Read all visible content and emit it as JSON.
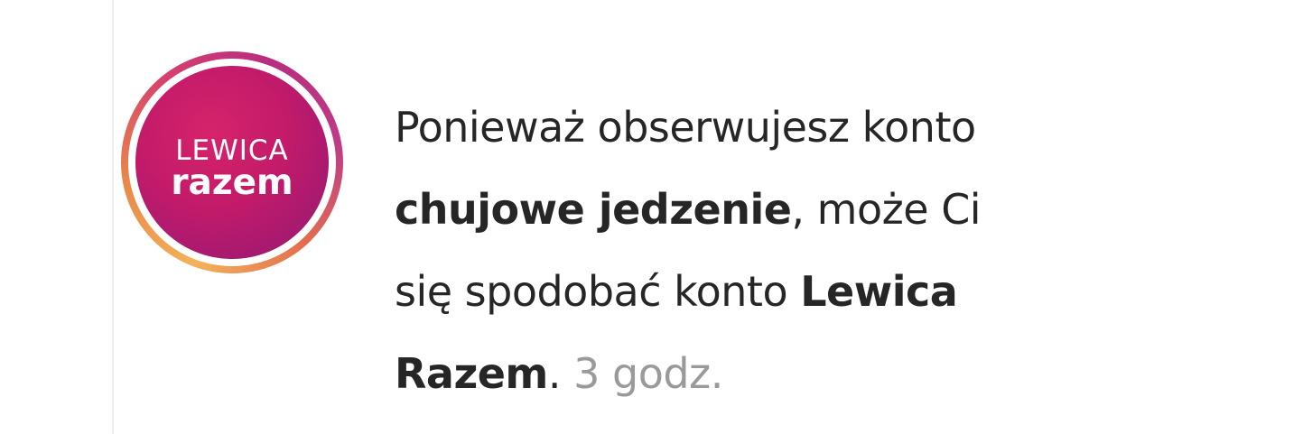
{
  "notification": {
    "avatar": {
      "logo_line1": "LEWICA",
      "logo_line2": "razem"
    },
    "message": {
      "line1": "Ponieważ obserwujesz konto",
      "account1": "chujowe jedzenie",
      "line2_rest": ", może Ci",
      "line3_start": "się spodobać konto ",
      "account2_part1": "Lewica",
      "account2_part2": "Razem",
      "period": ".",
      "time": "3 godz."
    }
  }
}
